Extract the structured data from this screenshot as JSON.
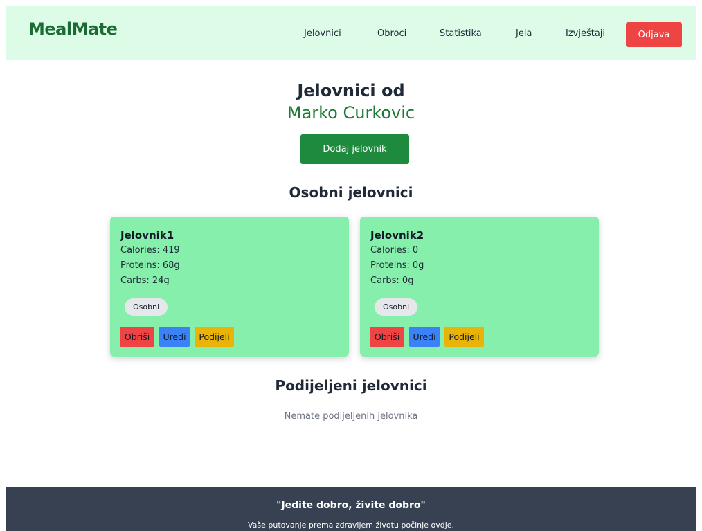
{
  "nav": {
    "brand": "MealMate",
    "links": [
      "Jelovnici",
      "Obroci",
      "Statistika",
      "Jela",
      "Izvještaji"
    ],
    "logout_label": "Odjava"
  },
  "header": {
    "title": "Jelovnici od",
    "owner": "Marko Curkovic",
    "add_button": "Dodaj jelovnik"
  },
  "personal": {
    "section_title": "Osobni jelovnici",
    "menus": [
      {
        "name": "Jelovnik1",
        "calories": "Calories: 419",
        "proteins": "Proteins: 68g",
        "carbs": "Carbs: 24g",
        "badge": "Osobni",
        "delete_label": "Obriši",
        "edit_label": "Uredi",
        "share_label": "Podijeli"
      },
      {
        "name": "Jelovnik2",
        "calories": "Calories: 0",
        "proteins": "Proteins: 0g",
        "carbs": "Carbs: 0g",
        "badge": "Osobni",
        "delete_label": "Obriši",
        "edit_label": "Uredi",
        "share_label": "Podijeli"
      }
    ]
  },
  "shared": {
    "section_title": "Podijeljeni jelovnici",
    "empty_message": "Nemate podijeljenih jelovnika"
  },
  "footer": {
    "quote": "\"Jedite dobro, živite dobro\"",
    "subtitle": "Vaše putovanje prema zdravijem životu počinje ovdje."
  },
  "colors": {
    "nav_bg": "#dcfce7",
    "brand": "#1b6b33",
    "card_bg": "#86efac",
    "delete": "#ef4444",
    "edit": "#3b82f6",
    "share": "#eab308",
    "footer_bg": "#374151"
  }
}
